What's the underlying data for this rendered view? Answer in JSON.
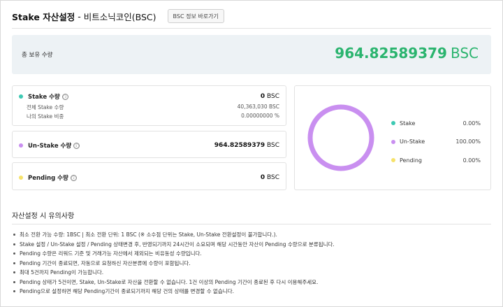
{
  "header": {
    "title": "Stake 자산설정",
    "separator": "-",
    "coin": "비트소닉코인(BSC)",
    "button_label": "BSC 정보 바로가기"
  },
  "total": {
    "label": "총 보유 수량",
    "value": "964.82589379",
    "unit": "BSC"
  },
  "stake": {
    "label": "Stake 수량",
    "value": "0",
    "unit": "BSC",
    "rows": [
      {
        "label": "전체 Stake 수량",
        "value": "40,363,030 BSC"
      },
      {
        "label": "나의 Stake 비중",
        "value": "0.00000000 %"
      }
    ]
  },
  "unstake": {
    "label": "Un-Stake 수량",
    "value": "964.82589379",
    "unit": "BSC"
  },
  "pending": {
    "label": "Pending 수량",
    "value": "0",
    "unit": "BSC"
  },
  "info_icon": "ⓘ",
  "legend": [
    {
      "name": "Stake",
      "pct": "0.00%",
      "color": "#3dc9b3",
      "value": 0
    },
    {
      "name": "Un-Stake",
      "pct": "100.00%",
      "color": "#c98ff0",
      "value": 100
    },
    {
      "name": "Pending",
      "pct": "0.00%",
      "color": "#f6e26a",
      "value": 0
    }
  ],
  "notes": {
    "title": "자산설정 시 유의사항",
    "items": [
      "최소 전환 가능 수량: 1BSC  |  최소 전환 단위: 1 BSC (※ 소수점 단위는 Stake, Un-Stake 전환설정이 불가합니다.).",
      "Stake 설정 / Un-Stake 설정 / Pending 상태변경 후, 반영되기까지 24시간이 소요되며 해당 시간동안 자산이 Pending 수량으로 분류됩니다.",
      "Pending 수량은 리워드 기준 및 거래가능 자산에서 제외되는 비유동성 수량입니다.",
      "Pending 기간이 종료되면, 자동으로 요청하신 자산분류에 수량이 포함됩니다.",
      "최대 5건까지 Pending이 가능합니다.",
      "Pending 상태가 5건이면, Stake, Un-Stake로 자산을 전환할 수 없습니다. 1건 이상의 Pending 기간이 종료된 후 다시 이용해주세요.",
      "Pending으로 설정하면 해당 Pending기간이 종료되기까지 해당 건의 상태를 변경할 수 없습니다."
    ]
  }
}
